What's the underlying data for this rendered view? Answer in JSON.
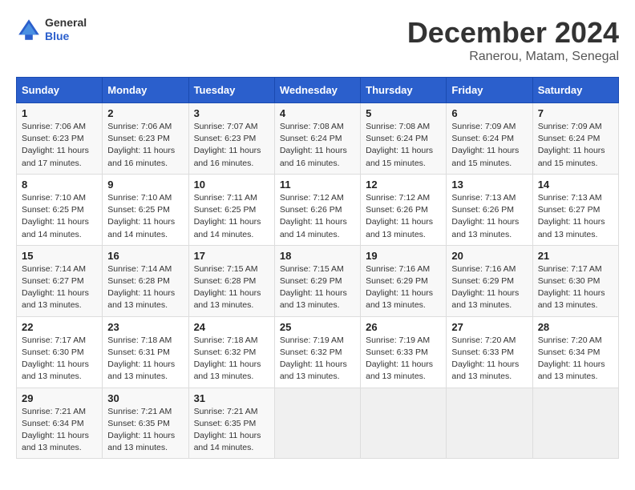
{
  "header": {
    "logo_general": "General",
    "logo_blue": "Blue",
    "month_title": "December 2024",
    "location": "Ranerou, Matam, Senegal"
  },
  "days_of_week": [
    "Sunday",
    "Monday",
    "Tuesday",
    "Wednesday",
    "Thursday",
    "Friday",
    "Saturday"
  ],
  "weeks": [
    [
      {
        "day": 1,
        "sunrise": "Sunrise: 7:06 AM",
        "sunset": "Sunset: 6:23 PM",
        "daylight": "Daylight: 11 hours and 17 minutes."
      },
      {
        "day": 2,
        "sunrise": "Sunrise: 7:06 AM",
        "sunset": "Sunset: 6:23 PM",
        "daylight": "Daylight: 11 hours and 16 minutes."
      },
      {
        "day": 3,
        "sunrise": "Sunrise: 7:07 AM",
        "sunset": "Sunset: 6:23 PM",
        "daylight": "Daylight: 11 hours and 16 minutes."
      },
      {
        "day": 4,
        "sunrise": "Sunrise: 7:08 AM",
        "sunset": "Sunset: 6:24 PM",
        "daylight": "Daylight: 11 hours and 16 minutes."
      },
      {
        "day": 5,
        "sunrise": "Sunrise: 7:08 AM",
        "sunset": "Sunset: 6:24 PM",
        "daylight": "Daylight: 11 hours and 15 minutes."
      },
      {
        "day": 6,
        "sunrise": "Sunrise: 7:09 AM",
        "sunset": "Sunset: 6:24 PM",
        "daylight": "Daylight: 11 hours and 15 minutes."
      },
      {
        "day": 7,
        "sunrise": "Sunrise: 7:09 AM",
        "sunset": "Sunset: 6:24 PM",
        "daylight": "Daylight: 11 hours and 15 minutes."
      }
    ],
    [
      {
        "day": 8,
        "sunrise": "Sunrise: 7:10 AM",
        "sunset": "Sunset: 6:25 PM",
        "daylight": "Daylight: 11 hours and 14 minutes."
      },
      {
        "day": 9,
        "sunrise": "Sunrise: 7:10 AM",
        "sunset": "Sunset: 6:25 PM",
        "daylight": "Daylight: 11 hours and 14 minutes."
      },
      {
        "day": 10,
        "sunrise": "Sunrise: 7:11 AM",
        "sunset": "Sunset: 6:25 PM",
        "daylight": "Daylight: 11 hours and 14 minutes."
      },
      {
        "day": 11,
        "sunrise": "Sunrise: 7:12 AM",
        "sunset": "Sunset: 6:26 PM",
        "daylight": "Daylight: 11 hours and 14 minutes."
      },
      {
        "day": 12,
        "sunrise": "Sunrise: 7:12 AM",
        "sunset": "Sunset: 6:26 PM",
        "daylight": "Daylight: 11 hours and 13 minutes."
      },
      {
        "day": 13,
        "sunrise": "Sunrise: 7:13 AM",
        "sunset": "Sunset: 6:26 PM",
        "daylight": "Daylight: 11 hours and 13 minutes."
      },
      {
        "day": 14,
        "sunrise": "Sunrise: 7:13 AM",
        "sunset": "Sunset: 6:27 PM",
        "daylight": "Daylight: 11 hours and 13 minutes."
      }
    ],
    [
      {
        "day": 15,
        "sunrise": "Sunrise: 7:14 AM",
        "sunset": "Sunset: 6:27 PM",
        "daylight": "Daylight: 11 hours and 13 minutes."
      },
      {
        "day": 16,
        "sunrise": "Sunrise: 7:14 AM",
        "sunset": "Sunset: 6:28 PM",
        "daylight": "Daylight: 11 hours and 13 minutes."
      },
      {
        "day": 17,
        "sunrise": "Sunrise: 7:15 AM",
        "sunset": "Sunset: 6:28 PM",
        "daylight": "Daylight: 11 hours and 13 minutes."
      },
      {
        "day": 18,
        "sunrise": "Sunrise: 7:15 AM",
        "sunset": "Sunset: 6:29 PM",
        "daylight": "Daylight: 11 hours and 13 minutes."
      },
      {
        "day": 19,
        "sunrise": "Sunrise: 7:16 AM",
        "sunset": "Sunset: 6:29 PM",
        "daylight": "Daylight: 11 hours and 13 minutes."
      },
      {
        "day": 20,
        "sunrise": "Sunrise: 7:16 AM",
        "sunset": "Sunset: 6:29 PM",
        "daylight": "Daylight: 11 hours and 13 minutes."
      },
      {
        "day": 21,
        "sunrise": "Sunrise: 7:17 AM",
        "sunset": "Sunset: 6:30 PM",
        "daylight": "Daylight: 11 hours and 13 minutes."
      }
    ],
    [
      {
        "day": 22,
        "sunrise": "Sunrise: 7:17 AM",
        "sunset": "Sunset: 6:30 PM",
        "daylight": "Daylight: 11 hours and 13 minutes."
      },
      {
        "day": 23,
        "sunrise": "Sunrise: 7:18 AM",
        "sunset": "Sunset: 6:31 PM",
        "daylight": "Daylight: 11 hours and 13 minutes."
      },
      {
        "day": 24,
        "sunrise": "Sunrise: 7:18 AM",
        "sunset": "Sunset: 6:32 PM",
        "daylight": "Daylight: 11 hours and 13 minutes."
      },
      {
        "day": 25,
        "sunrise": "Sunrise: 7:19 AM",
        "sunset": "Sunset: 6:32 PM",
        "daylight": "Daylight: 11 hours and 13 minutes."
      },
      {
        "day": 26,
        "sunrise": "Sunrise: 7:19 AM",
        "sunset": "Sunset: 6:33 PM",
        "daylight": "Daylight: 11 hours and 13 minutes."
      },
      {
        "day": 27,
        "sunrise": "Sunrise: 7:20 AM",
        "sunset": "Sunset: 6:33 PM",
        "daylight": "Daylight: 11 hours and 13 minutes."
      },
      {
        "day": 28,
        "sunrise": "Sunrise: 7:20 AM",
        "sunset": "Sunset: 6:34 PM",
        "daylight": "Daylight: 11 hours and 13 minutes."
      }
    ],
    [
      {
        "day": 29,
        "sunrise": "Sunrise: 7:21 AM",
        "sunset": "Sunset: 6:34 PM",
        "daylight": "Daylight: 11 hours and 13 minutes."
      },
      {
        "day": 30,
        "sunrise": "Sunrise: 7:21 AM",
        "sunset": "Sunset: 6:35 PM",
        "daylight": "Daylight: 11 hours and 13 minutes."
      },
      {
        "day": 31,
        "sunrise": "Sunrise: 7:21 AM",
        "sunset": "Sunset: 6:35 PM",
        "daylight": "Daylight: 11 hours and 14 minutes."
      },
      null,
      null,
      null,
      null
    ]
  ]
}
